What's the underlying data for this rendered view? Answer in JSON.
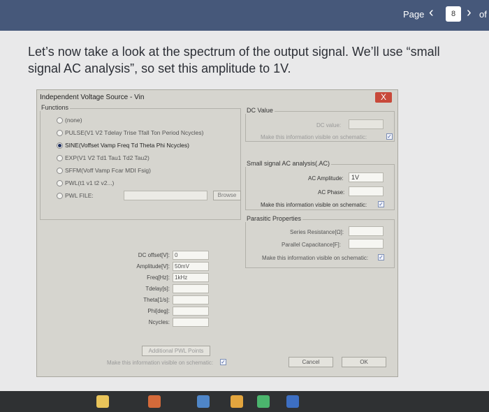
{
  "viewer": {
    "page_label": "Page",
    "page_number": "8",
    "page_of": "of"
  },
  "slide": {
    "instruction": "Let’s now take a look at the spectrum of the output signal. We’ll use “small signal AC analysis”, so set this amplitude to 1V."
  },
  "dialog": {
    "title": "Independent Voltage Source - Vin",
    "close_label": "X",
    "functions": {
      "label": "Functions",
      "options": [
        {
          "label": "(none)",
          "selected": false
        },
        {
          "label": "PULSE(V1 V2 Tdelay Trise Tfall Ton Period Ncycles)",
          "selected": false
        },
        {
          "label": "SINE(Voffset Vamp Freq Td Theta Phi Ncycles)",
          "selected": true
        },
        {
          "label": "EXP(V1 V2 Td1 Tau1 Td2 Tau2)",
          "selected": false
        },
        {
          "label": "SFFM(Voff Vamp Fcar MDI Fsig)",
          "selected": false
        },
        {
          "label": "PWL(t1 v1 t2 v2...)",
          "selected": false
        },
        {
          "label": "PWL FILE:",
          "selected": false
        }
      ],
      "browse_label": "Browse"
    },
    "sine_params": [
      {
        "label": "DC offset[V]:",
        "value": "0"
      },
      {
        "label": "Amplitude[V]:",
        "value": "50mV"
      },
      {
        "label": "Freq[Hz]:",
        "value": "1kHz"
      },
      {
        "label": "Tdelay[s]:",
        "value": ""
      },
      {
        "label": "Theta[1/s]:",
        "value": ""
      },
      {
        "label": "Phi[deg]:",
        "value": ""
      },
      {
        "label": "Ncycles:",
        "value": ""
      }
    ],
    "additional_pwl_label": "Additional PWL Points",
    "left_visible_label": "Make this information visible on schematic:",
    "dc": {
      "label": "DC Value",
      "value_label": "DC value:",
      "visible_label": "Make this information visible on schematic:"
    },
    "ac": {
      "label": "Small signal AC analysis(.AC)",
      "amplitude_label": "AC Amplitude:",
      "amplitude_value": "1V",
      "phase_label": "AC Phase:",
      "visible_label": "Make this information visible on schematic:"
    },
    "parasitic": {
      "label": "Parasitic Properties",
      "series_label": "Series Resistance[Ω]:",
      "parallel_label": "Parallel Capacitance[F]:",
      "visible_label": "Make this information visible on schematic:"
    },
    "cancel_label": "Cancel",
    "ok_label": "OK"
  },
  "colors": {
    "viewer_bar": "#46587a",
    "slide_bg": "#e9e9ea",
    "dialog_bg": "#d6d5cf",
    "close_button": "#c8493a"
  }
}
